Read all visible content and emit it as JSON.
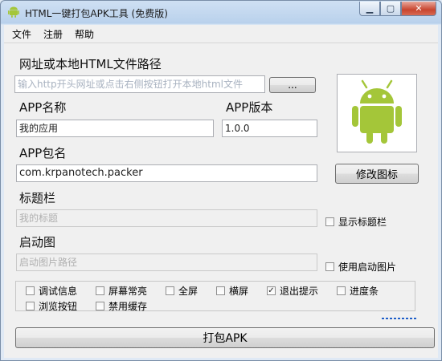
{
  "window": {
    "title": "HTML一键打包APK工具 (免费版)"
  },
  "menu": [
    "文件",
    "注册",
    "帮助"
  ],
  "form": {
    "url_label": "网址或本地HTML文件路径",
    "url_placeholder": "输入http开头网址或点击右侧按钮打开本地html文件",
    "browse_label": "...",
    "app_name_label": "APP名称",
    "app_name_value": "我的应用",
    "app_version_label": "APP版本",
    "app_version_value": "1.0.0",
    "package_label": "APP包名",
    "package_value": "com.krpanotech.packer",
    "change_icon_label": "修改图标",
    "titlebar_label": "标题栏",
    "titlebar_value": "我的标题",
    "show_titlebar_label": "显示标题栏",
    "splash_label": "启动图",
    "splash_placeholder": "启动图片路径",
    "use_splash_label": "使用启动图片"
  },
  "options": [
    {
      "label": "调试信息",
      "checked": false
    },
    {
      "label": "屏幕常亮",
      "checked": false
    },
    {
      "label": "全屏",
      "checked": false
    },
    {
      "label": "横屏",
      "checked": false
    },
    {
      "label": "退出提示",
      "checked": true
    },
    {
      "label": "进度条",
      "checked": false
    },
    {
      "label": "浏览按钮",
      "checked": false
    },
    {
      "label": "禁用缓存",
      "checked": false
    }
  ],
  "actions": {
    "pack_label": "打包APK"
  },
  "icons": {
    "app": "android-icon",
    "preview": "android-robot-icon"
  },
  "colors": {
    "android_green": "#a4c639",
    "link_blue": "#1f5fc9"
  }
}
